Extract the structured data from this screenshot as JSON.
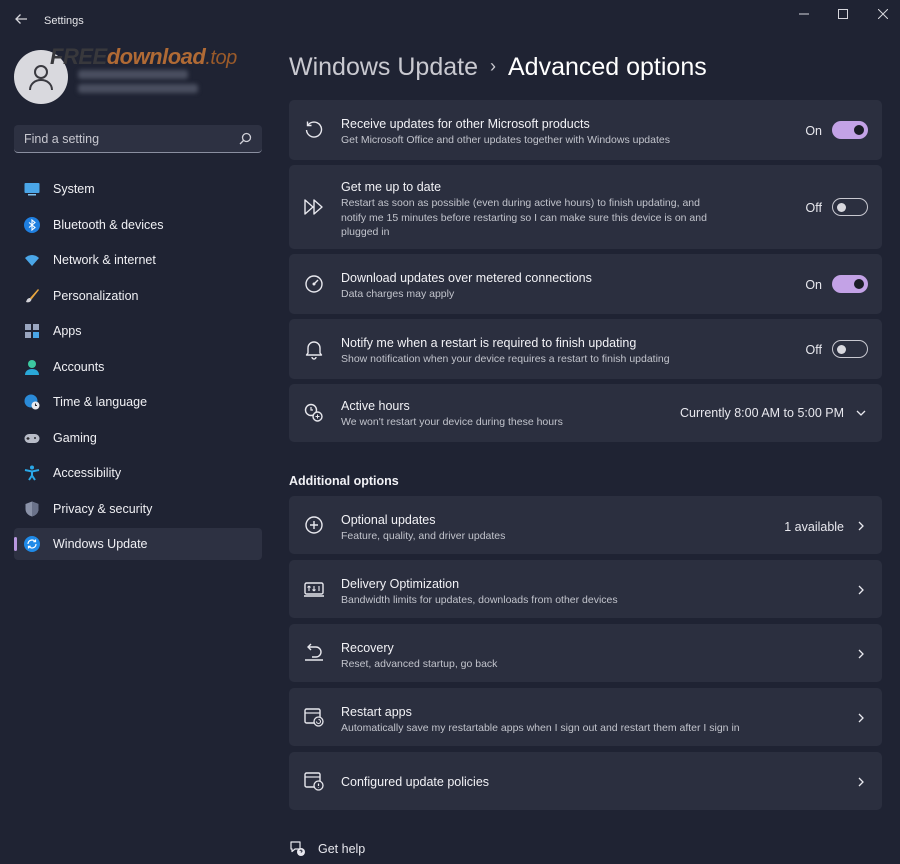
{
  "window": {
    "title": "Settings"
  },
  "sidebar": {
    "search_placeholder": "Find a setting",
    "items": [
      {
        "label": "System",
        "icon": "monitor-icon"
      },
      {
        "label": "Bluetooth & devices",
        "icon": "bluetooth-icon"
      },
      {
        "label": "Network & internet",
        "icon": "wifi-icon"
      },
      {
        "label": "Personalization",
        "icon": "brush-icon"
      },
      {
        "label": "Apps",
        "icon": "apps-icon"
      },
      {
        "label": "Accounts",
        "icon": "person-icon"
      },
      {
        "label": "Time & language",
        "icon": "globe-clock-icon"
      },
      {
        "label": "Gaming",
        "icon": "gamepad-icon"
      },
      {
        "label": "Accessibility",
        "icon": "accessibility-icon"
      },
      {
        "label": "Privacy & security",
        "icon": "shield-icon"
      },
      {
        "label": "Windows Update",
        "icon": "sync-icon",
        "active": true
      }
    ]
  },
  "watermark": {
    "free": "FREE",
    "name": "download",
    "tld": ".top"
  },
  "breadcrumb": {
    "parent": "Windows Update",
    "separator": "›",
    "current": "Advanced options"
  },
  "settings": [
    {
      "title": "Receive updates for other Microsoft products",
      "description": "Get Microsoft Office and other updates together with Windows updates",
      "state": "On",
      "toggle_on": true,
      "icon": "refresh-icon"
    },
    {
      "title": "Get me up to date",
      "description": "Restart as soon as possible (even during active hours) to finish updating, and notify me 15 minutes before restarting so I can make sure this device is on and plugged in",
      "state": "Off",
      "toggle_on": false,
      "icon": "fast-forward-icon"
    },
    {
      "title": "Download updates over metered connections",
      "description": "Data charges may apply",
      "state": "On",
      "toggle_on": true,
      "icon": "gauge-icon"
    },
    {
      "title": "Notify me when a restart is required to finish updating",
      "description": "Show notification when your device requires a restart to finish updating",
      "state": "Off",
      "toggle_on": false,
      "icon": "bell-icon"
    },
    {
      "title": "Active hours",
      "description": "We won't restart your device during these hours",
      "value": "Currently 8:00 AM to 5:00 PM",
      "icon": "clock-icon"
    }
  ],
  "additional": {
    "title": "Additional options",
    "items": [
      {
        "title": "Optional updates",
        "description": "Feature, quality, and driver updates",
        "value": "1 available",
        "icon": "plus-circle-icon"
      },
      {
        "title": "Delivery Optimization",
        "description": "Bandwidth limits for updates, downloads from other devices",
        "icon": "delivery-icon"
      },
      {
        "title": "Recovery",
        "description": "Reset, advanced startup, go back",
        "icon": "recovery-icon"
      },
      {
        "title": "Restart apps",
        "description": "Automatically save my restartable apps when I sign out and restart them after I sign in",
        "icon": "restart-apps-icon"
      },
      {
        "title": "Configured update policies",
        "description": "",
        "icon": "policy-icon"
      }
    ]
  },
  "help": {
    "label": "Get help"
  },
  "colors": {
    "background": "#1f2333",
    "card": "#2b2f3f",
    "accent": "#c3a2e6"
  }
}
